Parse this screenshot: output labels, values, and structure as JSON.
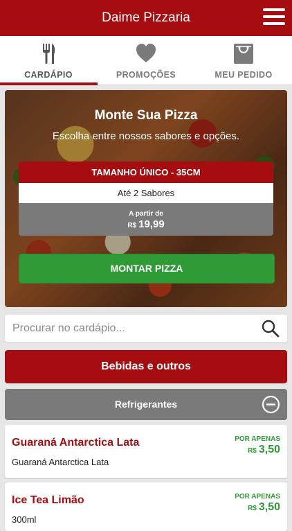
{
  "app": {
    "title": "Daime Pizzaria"
  },
  "tabs": [
    {
      "label": "CARDÁPIO",
      "icon": "fork-knife-icon",
      "active": true
    },
    {
      "label": "PROMOÇÕES",
      "icon": "heart-icon",
      "active": false
    },
    {
      "label": "MEU PEDIDO",
      "icon": "shopping-bag-icon",
      "active": false
    }
  ],
  "hero": {
    "title": "Monte Sua Pizza",
    "subtitle": "Escolha entre nossos sabores e opções.",
    "size_label": "TAMANHO ÚNICO - 35CM",
    "flavors": "Até 2 Sabores",
    "from_label": "A partir de",
    "currency": "R$",
    "price": "19,99",
    "button": "MONTAR PIZZA"
  },
  "search": {
    "placeholder": "Procurar no cardápio..."
  },
  "category": {
    "label": "Bebidas e outros"
  },
  "subcategory": {
    "label": "Refrigerantes"
  },
  "items": [
    {
      "name": "Guaraná Antarctica Lata",
      "description": "Guaraná Antarctica Lata",
      "tag": "POR APENAS",
      "currency": "R$",
      "price": "3,50"
    },
    {
      "name": "Ice Tea Limão",
      "description": "300ml",
      "tag": "POR APENAS",
      "currency": "R$",
      "price": "3,50"
    }
  ],
  "colors": {
    "brand": "#a50d10",
    "accent_green": "#2e9b36",
    "muted_gray": "#7a7a7a"
  }
}
